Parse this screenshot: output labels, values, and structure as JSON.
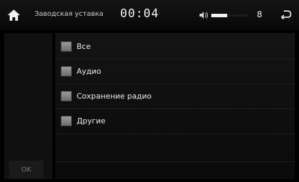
{
  "header": {
    "title": "Заводская уставка",
    "clock": "00:04",
    "volume": {
      "level": 0.45,
      "value": "8"
    }
  },
  "options": [
    {
      "label": "Все",
      "checked": true
    },
    {
      "label": "Аудио",
      "checked": true
    },
    {
      "label": "Сохранение радио",
      "checked": true
    },
    {
      "label": "Другие",
      "checked": true
    }
  ],
  "sidebar": {
    "ok_label": "OK"
  },
  "colors": {
    "background": "#000000",
    "text": "#e8e8e8",
    "checkbox": "#8a8a8a"
  }
}
